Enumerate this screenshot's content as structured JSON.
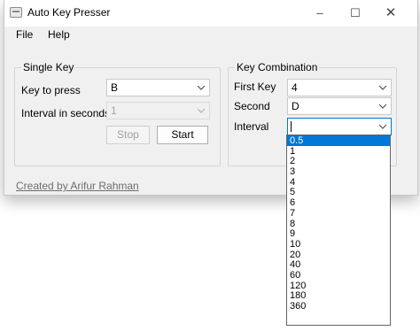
{
  "window": {
    "title": "Auto Key Presser"
  },
  "menu": {
    "file": "File",
    "help": "Help"
  },
  "single_key": {
    "group_title": "Single Key",
    "key_label": "Key to press",
    "key_value": "B",
    "interval_label": "Interval in seconds",
    "interval_value": "1",
    "stop_label": "Stop",
    "start_label": "Start"
  },
  "combo": {
    "group_title": "Key Combination",
    "first_key_label": "First Key",
    "first_key_value": "4",
    "second_label": "Second",
    "second_value": "D",
    "interval_label": "Interval",
    "interval_value": ""
  },
  "footer": {
    "credit": "Created by Arifur Rahman"
  },
  "interval_options": [
    "0.5",
    "1",
    "2",
    "3",
    "4",
    "5",
    "6",
    "7",
    "8",
    "9",
    "10",
    "20",
    "40",
    "60",
    "120",
    "180",
    "360"
  ],
  "colors": {
    "accent": "#0078d7",
    "window_bg": "#f0f0f0",
    "disabled_text": "#a0a0a0"
  }
}
